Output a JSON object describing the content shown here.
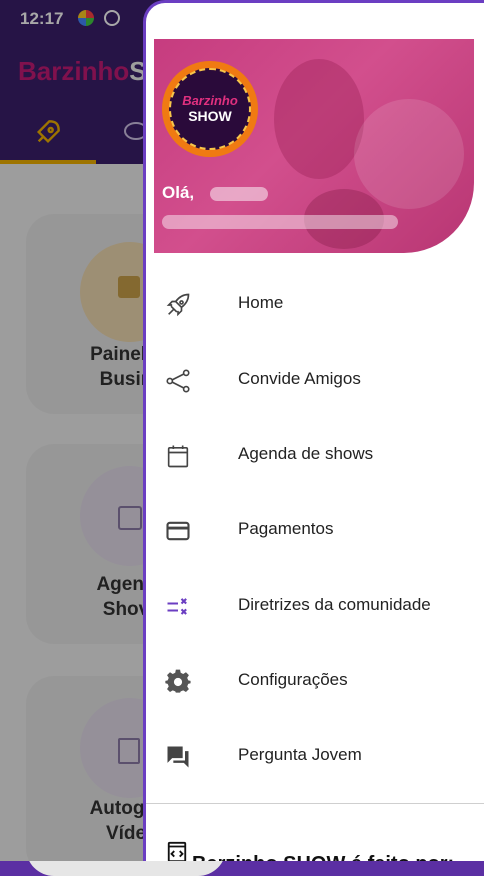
{
  "status_bar": {
    "time": "12:17"
  },
  "app": {
    "title_part1": "Barzinho",
    "title_part2": "S",
    "cards": [
      {
        "line1": "Painel s",
        "line2": "Busin"
      },
      {
        "line1": "Agend",
        "line2": "Shov"
      },
      {
        "line1": "Autogra",
        "line2": "Víde"
      }
    ]
  },
  "drawer": {
    "logo_top": "Barzinho",
    "logo_bottom": "SHOW",
    "greeting": "Olá,",
    "menu": [
      {
        "label": "Home",
        "icon": "rocket-icon"
      },
      {
        "label": "Convide Amigos",
        "icon": "share-icon"
      },
      {
        "label": "Agenda de shows",
        "icon": "calendar-icon"
      },
      {
        "label": "Pagamentos",
        "icon": "credit-card-icon"
      },
      {
        "label": "Diretrizes da comunidade",
        "icon": "rule-icon"
      },
      {
        "label": "Configurações",
        "icon": "gear-icon"
      },
      {
        "label": "Pergunta Jovem",
        "icon": "forum-icon"
      }
    ],
    "footer": "Barzinho SHOW é feito por:"
  },
  "colors": {
    "purple": "#6b3ec2",
    "pink": "#c63c7f",
    "orange": "#f07a12",
    "yellow": "#f0b100"
  }
}
